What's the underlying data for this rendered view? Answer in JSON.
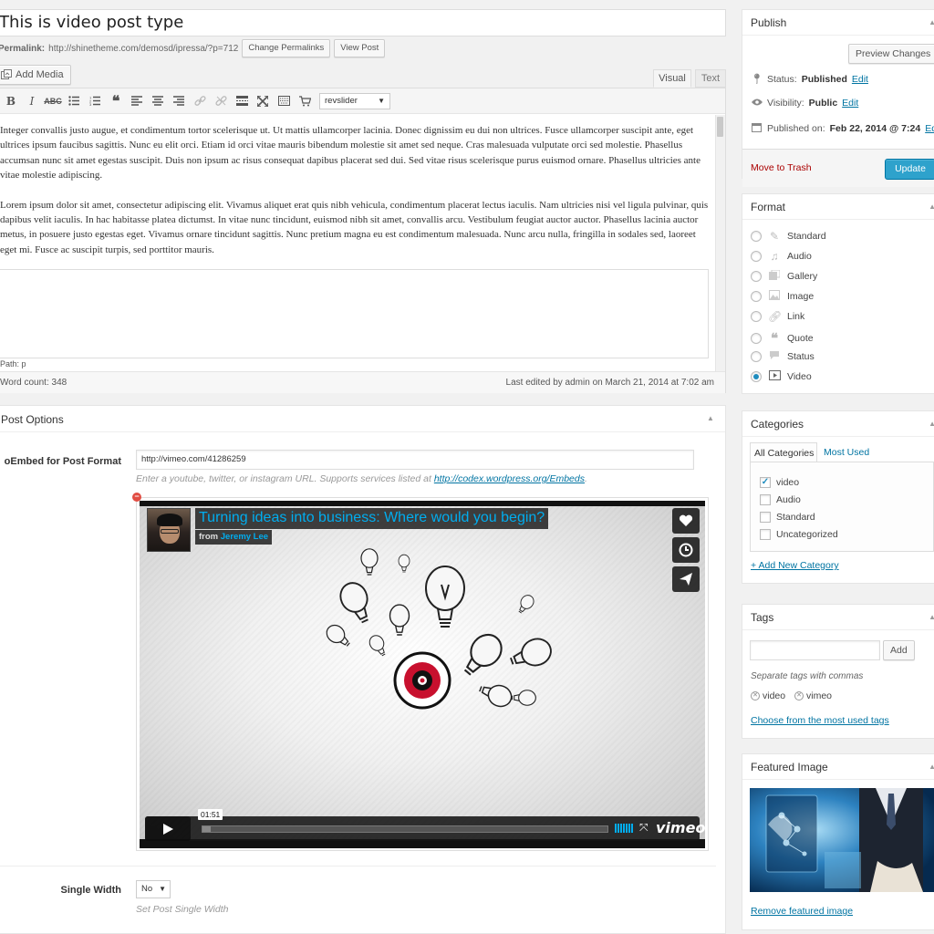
{
  "editor": {
    "title": "This is video post type",
    "permalink_label": "Permalink:",
    "permalink_url": "http://shinetheme.com/demosd/ipressa/?p=712",
    "change_permalinks": "Change Permalinks",
    "view_post": "View Post",
    "add_media": "Add Media",
    "tab_visual": "Visual",
    "tab_text": "Text",
    "toolbar_select": "revslider",
    "paragraphs": [
      "Integer convallis justo augue, et condimentum tortor scelerisque ut. Ut mattis ullamcorper lacinia. Donec dignissim eu dui non ultrices. Fusce ullamcorper suscipit ante, eget ultrices ipsum faucibus sagittis. Nunc eu elit orci. Etiam id orci vitae mauris bibendum molestie sit amet sed neque. Cras malesuada vulputate orci sed molestie. Phasellus accumsan nunc sit amet egestas suscipit. Duis non ipsum ac risus consequat dapibus placerat sed dui. Sed vitae risus scelerisque purus euismod ornare. Phasellus ultricies ante vitae molestie adipiscing.",
      "Lorem ipsum dolor sit amet, consectetur adipiscing elit. Vivamus aliquet erat quis nibh vehicula, condimentum placerat lectus iaculis. Nam ultricies nisi vel ligula pulvinar, quis dapibus velit iaculis. In hac habitasse platea dictumst. In vitae nunc tincidunt, euismod nibh sit amet, convallis arcu. Vestibulum feugiat auctor auctor. Phasellus lacinia auctor metus, in posuere justo egestas eget. Vivamus ornare tincidunt sagittis. Nunc pretium magna eu est condimentum malesuada. Nunc arcu nulla, fringilla in sodales sed, laoreet eget mi. Fusce ac suscipit turpis, sed porttitor mauris."
    ],
    "path": "Path: p",
    "word_count": "Word count: 348",
    "last_edited": "Last edited by admin on March 21, 2014 at 7:02 am"
  },
  "post_options": {
    "heading": "Post Options",
    "oembed_label": "oEmbed for Post Format",
    "oembed_value": "http://vimeo.com/41286259",
    "oembed_help_prefix": "Enter a youtube, twitter, or instagram URL. Supports services listed at ",
    "oembed_help_link": "http://codex.wordpress.org/Embeds",
    "oembed_help_suffix": ".",
    "video": {
      "title": "Turning ideas into business: Where would you begin?",
      "from_label": "from",
      "author": "Jeremy Lee",
      "time": "01:51",
      "logo": "vimeo",
      "progress": 0.02
    },
    "single_width_label": "Single Width",
    "single_width_value": "No",
    "single_width_help": "Set Post Single Width"
  },
  "publish": {
    "heading": "Publish",
    "preview_changes": "Preview Changes",
    "status_label": "Status:",
    "status_value": "Published",
    "visibility_label": "Visibility:",
    "visibility_value": "Public",
    "published_label": "Published on:",
    "published_value": "Feb 22, 2014 @ 7:24",
    "edit": "Edit",
    "move_to_trash": "Move to Trash",
    "update": "Update"
  },
  "format": {
    "heading": "Format",
    "options": [
      {
        "label": "Standard",
        "icon": "pin-icon",
        "selected": false
      },
      {
        "label": "Audio",
        "icon": "music-icon",
        "selected": false
      },
      {
        "label": "Gallery",
        "icon": "gallery-icon",
        "selected": false
      },
      {
        "label": "Image",
        "icon": "image-icon",
        "selected": false
      },
      {
        "label": "Link",
        "icon": "link-icon",
        "selected": false
      },
      {
        "label": "Quote",
        "icon": "quote-icon",
        "selected": false
      },
      {
        "label": "Status",
        "icon": "status-icon",
        "selected": false
      },
      {
        "label": "Video",
        "icon": "video-icon",
        "selected": true
      }
    ]
  },
  "categories": {
    "heading": "Categories",
    "tab_all": "All Categories",
    "tab_most_used": "Most Used",
    "items": [
      {
        "label": "video",
        "checked": true
      },
      {
        "label": "Audio",
        "checked": false
      },
      {
        "label": "Standard",
        "checked": false
      },
      {
        "label": "Uncategorized",
        "checked": false
      }
    ],
    "add_new": "+ Add New Category"
  },
  "tags": {
    "heading": "Tags",
    "add": "Add",
    "help": "Separate tags with commas",
    "items": [
      "video",
      "vimeo"
    ],
    "choose": "Choose from the most used tags"
  },
  "featured_image": {
    "heading": "Featured Image",
    "remove": "Remove featured image"
  },
  "colors": {
    "link": "#0074a2",
    "primary_button": "#2ea2cc",
    "vimeo_blue": "#00adef",
    "trash": "#aa0000"
  }
}
